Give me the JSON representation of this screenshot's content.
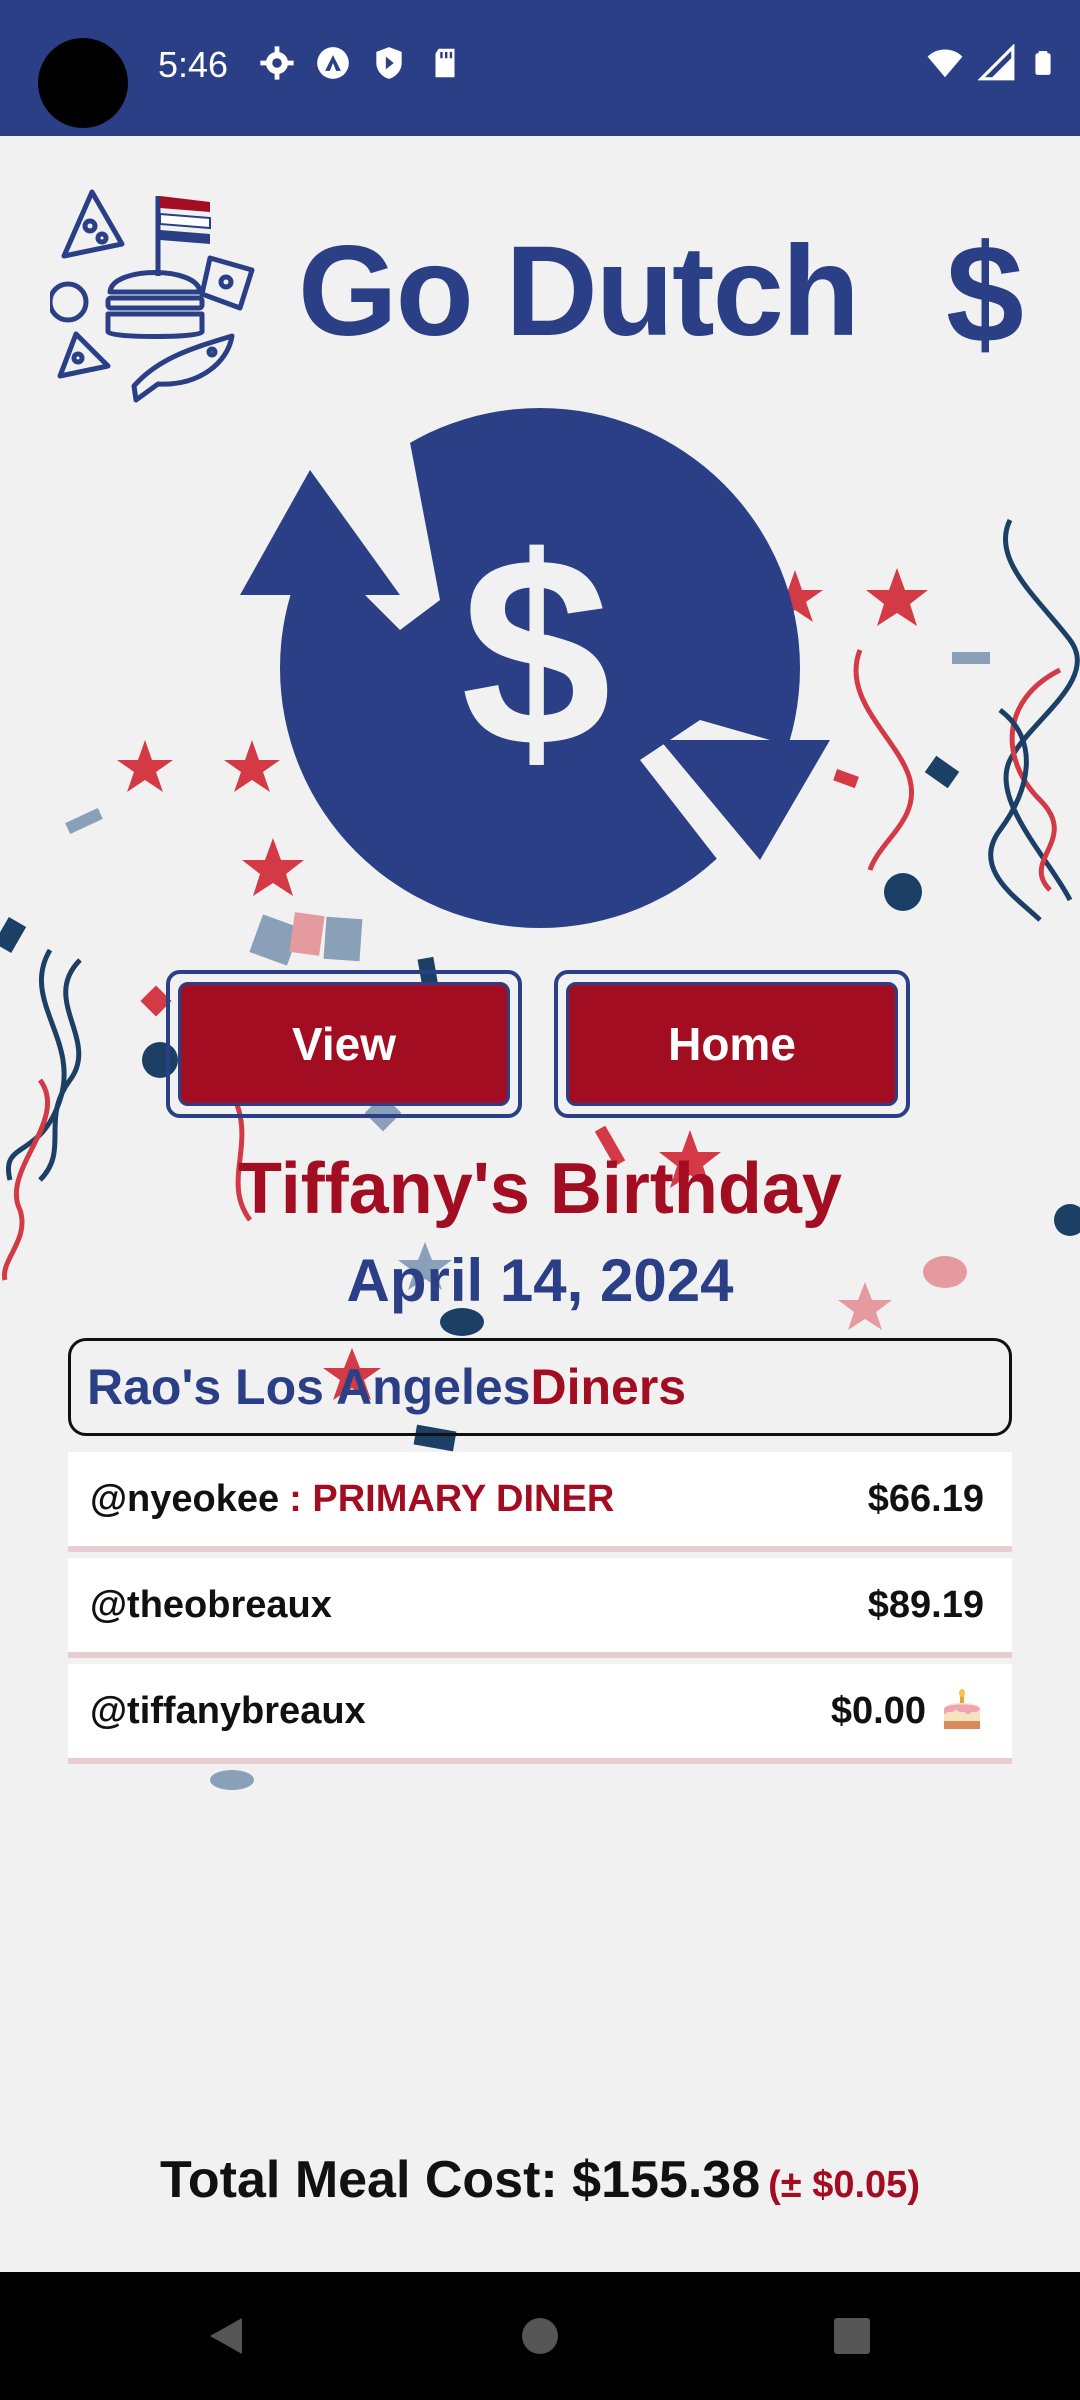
{
  "status_bar": {
    "time": "5:46",
    "icons_left": [
      "gear-icon",
      "vpn-icon",
      "play-protect-icon",
      "sd-card-icon"
    ],
    "icons_right": [
      "wifi-icon",
      "signal-icon",
      "battery-icon"
    ]
  },
  "header": {
    "title": "Go Dutch",
    "title_dollar": "$"
  },
  "logo": {
    "symbol": "$"
  },
  "buttons": {
    "view_label": "View",
    "home_label": "Home"
  },
  "event": {
    "title": "Tiffany's Birthday",
    "date": "April 14, 2024"
  },
  "restaurant": {
    "name": "Rao's Los Angeles",
    "diners_label": "Diners"
  },
  "diners": [
    {
      "handle": "@nyeokee",
      "tag": ": PRIMARY DINER",
      "amount": "$66.19"
    },
    {
      "handle": "@theobreaux",
      "tag": "",
      "amount": "$89.19"
    },
    {
      "handle": "@tiffanybreaux",
      "tag": "",
      "amount": "$0.00",
      "icon": "birthday-cake-icon"
    }
  ],
  "total": {
    "label": "Total Meal Cost: $155.38",
    "note": "(± $0.05)"
  },
  "colors": {
    "navy": "#2a3f86",
    "crimson": "#a30d22",
    "background": "#f1f1f1"
  },
  "nav_bar": {
    "icons": [
      "back-icon",
      "home-icon",
      "recents-icon"
    ]
  }
}
